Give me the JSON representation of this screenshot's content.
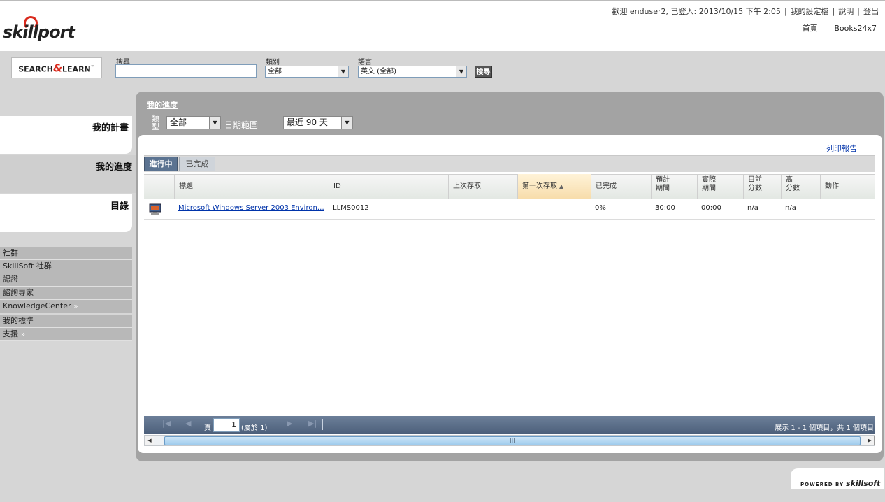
{
  "header": {
    "brand": "skillport",
    "welcome_text": "歡迎 enduser2, 已登入: 2013/10/15 下午 2:05",
    "my_profile": "我的設定檔",
    "help": "說明",
    "logout": "登出",
    "home": "首頁",
    "books": "Books24x7"
  },
  "search": {
    "logo_left": "SEARCH",
    "logo_amp": "&",
    "logo_right": "LEARN",
    "search_label": "搜尋",
    "search_value": "",
    "category_label": "類別",
    "category_value": "全部",
    "language_label": "語言",
    "language_value": "英文 (全部)",
    "button": "搜尋"
  },
  "nav": {
    "my_plan": "我的計畫",
    "my_progress": "我的進度",
    "catalog": "目錄",
    "side_items": [
      {
        "label": "社群",
        "chevron": false
      },
      {
        "label": "SkillSoft 社群",
        "chevron": false
      },
      {
        "label": "認證",
        "chevron": false
      },
      {
        "label": "諮詢專家",
        "chevron": false
      },
      {
        "label": "KnowledgeCenter",
        "chevron": true
      },
      {
        "label": "我的標準",
        "chevron": false
      },
      {
        "label": "支援",
        "chevron": true
      }
    ],
    "chevron_glyph": "»"
  },
  "main": {
    "title": "我的進度",
    "type_label": "類型",
    "type_value": "全部",
    "date_range_label": "日期範圍",
    "date_range_value": "最近 90 天",
    "print_report": "列印報告",
    "tabs": [
      {
        "label": "進行中",
        "active": true
      },
      {
        "label": "已完成",
        "active": false
      }
    ],
    "columns": [
      {
        "label": "標題"
      },
      {
        "label": "ID"
      },
      {
        "label": "上次存取"
      },
      {
        "label": "第一次存取",
        "sorted": "ascending"
      },
      {
        "label": "已完成"
      },
      {
        "label": "預計\n期間"
      },
      {
        "label": "實際\n期間"
      },
      {
        "label": "目前\n分數"
      },
      {
        "label": "高\n分數"
      },
      {
        "label": "動作"
      }
    ],
    "rows": [
      {
        "icon": "computer-course-icon",
        "title": "Microsoft Windows Server 2003 Environ…",
        "id": "LLMS0012",
        "last_access": "",
        "first_access": "",
        "completed": "0%",
        "estimated_duration": "30:00",
        "actual_duration": "00:00",
        "current_score": "n/a",
        "high_score": "n/a",
        "action": ""
      }
    ],
    "pager": {
      "page_label": "頁",
      "page_value": "1",
      "of_text": "(屬於 1)",
      "summary": "展示 1 - 1 個項目，共 1 個項目"
    }
  },
  "footer": {
    "powered_by": "POWERED BY",
    "brand": "skillsoft"
  },
  "colors": {
    "brand_red": "#d9291c",
    "active_tab": "#5b7391",
    "link": "#0033aa"
  }
}
